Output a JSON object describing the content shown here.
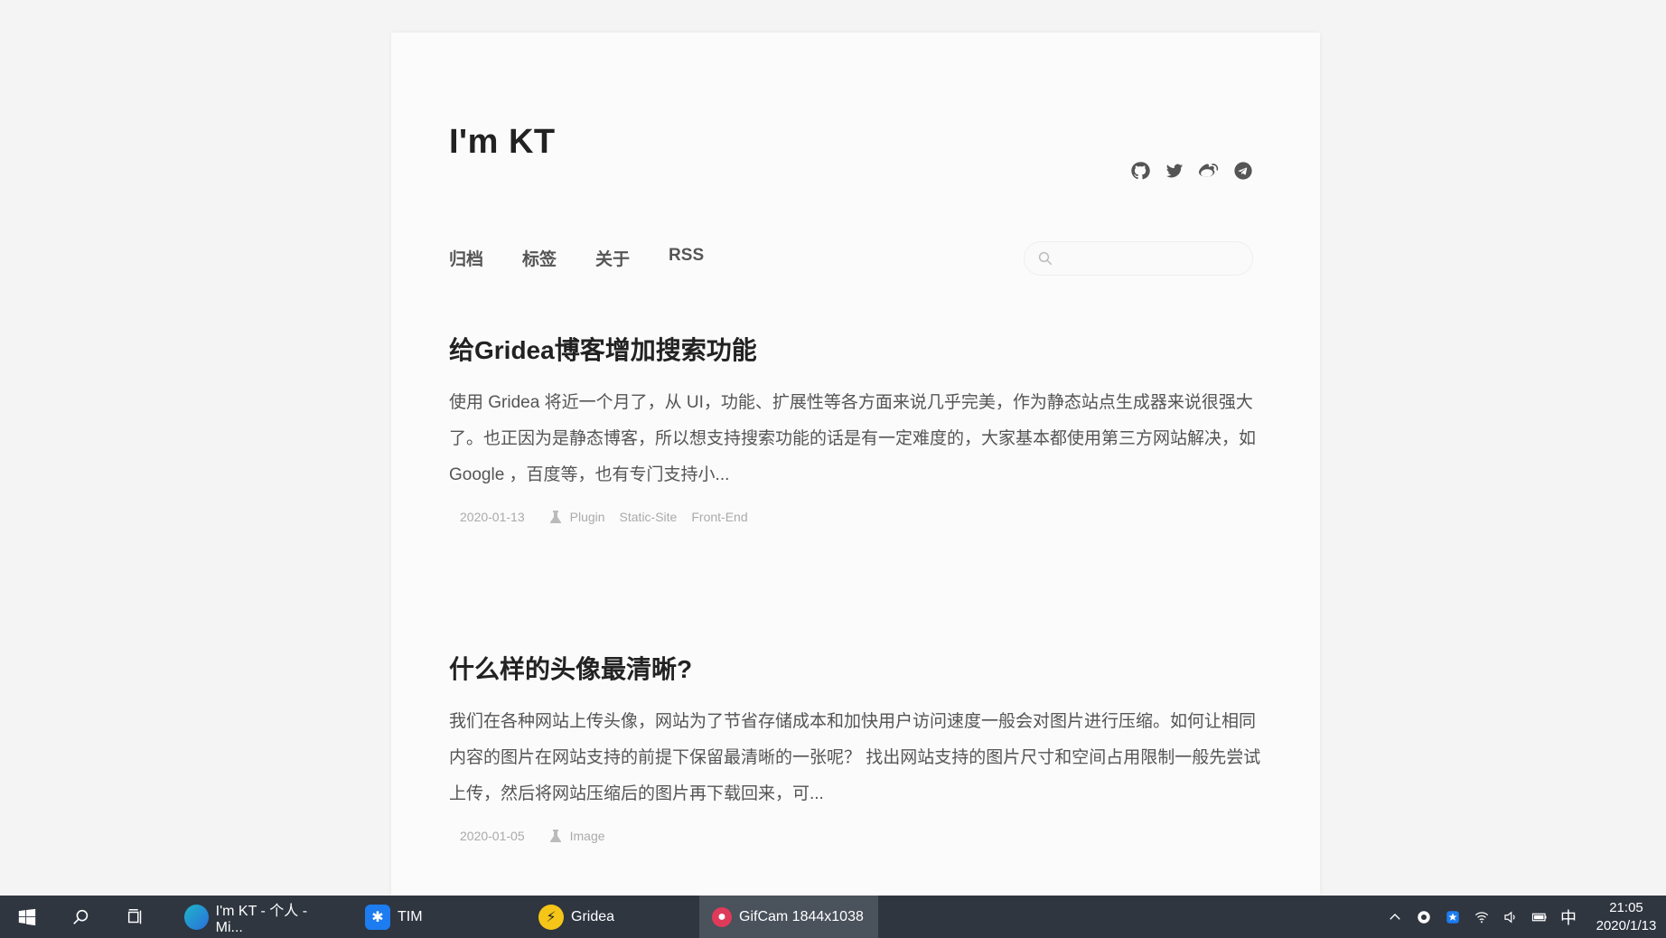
{
  "site": {
    "title": "I'm KT",
    "social_icons": [
      "github-icon",
      "twitter-icon",
      "weibo-icon",
      "telegram-icon"
    ]
  },
  "nav": {
    "items": [
      "归档",
      "标签",
      "关于",
      "RSS"
    ]
  },
  "search": {
    "placeholder": "",
    "value": ""
  },
  "posts": [
    {
      "title": "给Gridea博客增加搜索功能",
      "excerpt": "使用 Gridea 将近一个月了，从 UI，功能、扩展性等各方面来说几乎完美，作为静态站点生成器来说很强大了。也正因为是静态博客，所以想支持搜索功能的话是有一定难度的，大家基本都使用第三方网站解决，如 Google ，百度等，也有专门支持小...",
      "date": "2020-01-13",
      "tags": [
        "Plugin",
        "Static-Site",
        "Front-End"
      ]
    },
    {
      "title": "什么样的头像最清晰?",
      "excerpt": "我们在各种网站上传头像，网站为了节省存储成本和加快用户访问速度一般会对图片进行压缩。如何让相同内容的图片在网站支持的前提下保留最清晰的一张呢？ 找出网站支持的图片尺寸和空间占用限制一般先尝试上传，然后将网站压缩后的图片再下载回来，可...",
      "date": "2020-01-05",
      "tags": [
        "Image"
      ]
    }
  ],
  "taskbar": {
    "apps": [
      {
        "label": "I'm KT - 个人 - Mi...",
        "icon": "edge-icon"
      },
      {
        "label": "TIM",
        "icon": "tim-icon"
      },
      {
        "label": "Gridea",
        "icon": "gridea-icon"
      },
      {
        "label": "GifCam 1844x1038",
        "icon": "gifcam-icon"
      }
    ],
    "ime": "中",
    "time": "21:05",
    "date": "2020/1/13"
  },
  "colors": {
    "background": "#f4f4f4",
    "page": "#fbfbfb",
    "taskbar": "#2f3640",
    "text": "#555555",
    "meta": "#aaaaaa"
  }
}
